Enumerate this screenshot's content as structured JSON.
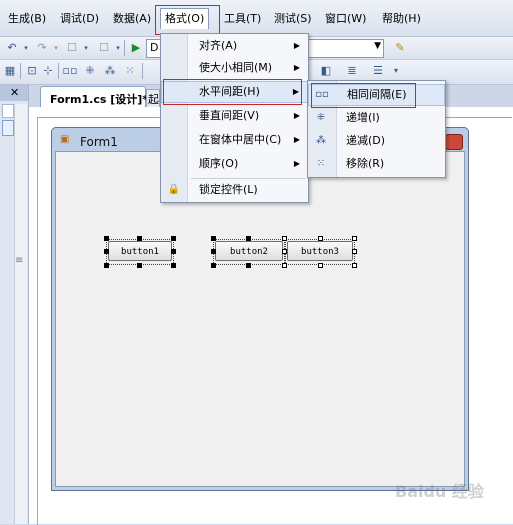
{
  "menubar": {
    "items": [
      "生成(B)",
      "调试(D)",
      "数据(A)",
      "格式(O)",
      "工具(T)",
      "测试(S)",
      "窗口(W)",
      "帮助(H)"
    ],
    "active_index": 3
  },
  "toolbar": {
    "combo_value": "D"
  },
  "tabs": {
    "active_label": "Form1.cs [设计]*",
    "next_label": "起"
  },
  "form": {
    "title": "Form1",
    "buttons": [
      "button1",
      "button2",
      "button3"
    ]
  },
  "format_menu": {
    "items": [
      {
        "label": "对齐(A)",
        "submenu": true
      },
      {
        "label": "使大小相同(M)",
        "submenu": true
      },
      {
        "label": "水平间距(H)",
        "submenu": true,
        "highlighted": true
      },
      {
        "label": "垂直间距(V)",
        "submenu": true
      },
      {
        "label": "在窗体中居中(C)",
        "submenu": true
      },
      {
        "label": "顺序(O)",
        "submenu": true
      },
      {
        "label": "锁定控件(L)",
        "submenu": false,
        "icon": "lock-icon"
      }
    ]
  },
  "spacing_submenu": {
    "items": [
      {
        "label": "相同间隔(E)",
        "icon": "make-equal-spacing-icon",
        "highlighted": true
      },
      {
        "label": "递增(I)",
        "icon": "increase-spacing-icon"
      },
      {
        "label": "递减(D)",
        "icon": "decrease-spacing-icon"
      },
      {
        "label": "移除(R)",
        "icon": "remove-spacing-icon"
      }
    ]
  },
  "colors": {
    "highlight_border": "#d0202a",
    "menu_highlight": "#dfe8f6"
  },
  "watermark": "Baidu 经验"
}
